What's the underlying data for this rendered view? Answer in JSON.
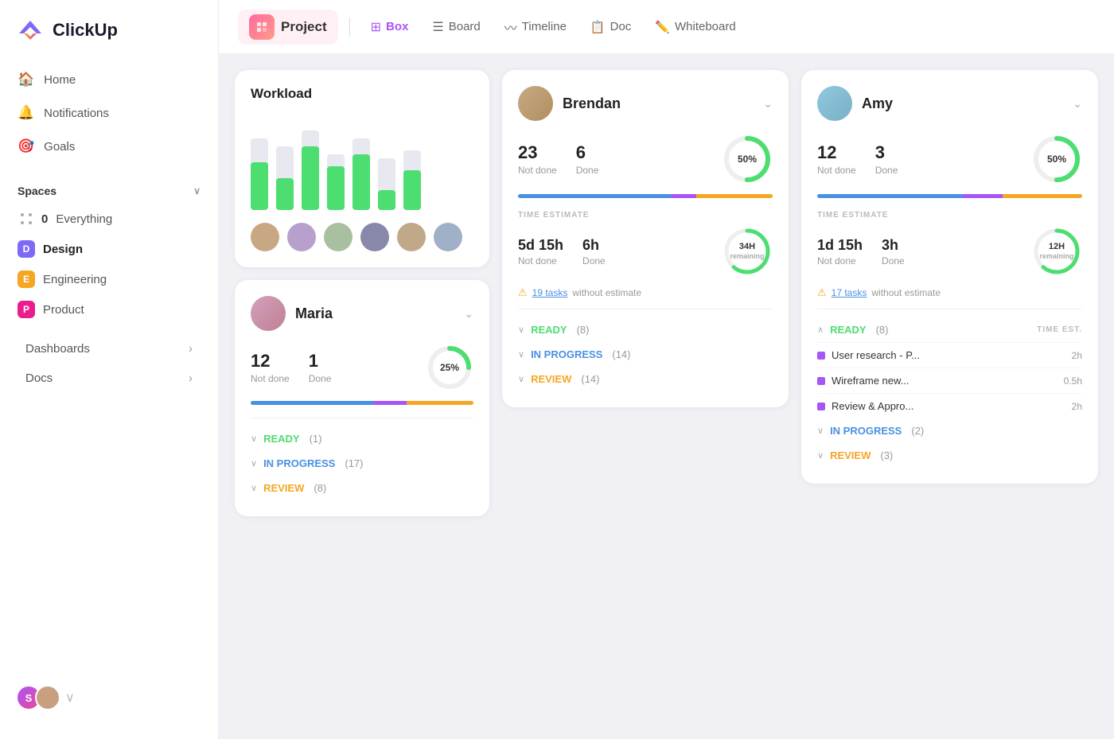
{
  "sidebar": {
    "logo_text": "ClickUp",
    "nav": [
      {
        "label": "Home",
        "icon": "home"
      },
      {
        "label": "Notifications",
        "icon": "bell"
      },
      {
        "label": "Goals",
        "icon": "target"
      }
    ],
    "spaces_title": "Spaces",
    "everything": {
      "num": 0,
      "label": "Everything"
    },
    "spaces": [
      {
        "badge": "D",
        "label": "Design",
        "class": "d",
        "bold": true
      },
      {
        "badge": "E",
        "label": "Engineering",
        "class": "e"
      },
      {
        "badge": "P",
        "label": "Product",
        "class": "p"
      }
    ],
    "bottom": [
      {
        "label": "Dashboards"
      },
      {
        "label": "Docs"
      }
    ]
  },
  "topbar": {
    "project_label": "Project",
    "tabs": [
      {
        "label": "Box",
        "icon": "⊞"
      },
      {
        "label": "Board",
        "icon": "☰"
      },
      {
        "label": "Timeline",
        "icon": "—"
      },
      {
        "label": "Doc",
        "icon": "📄"
      },
      {
        "label": "Whiteboard",
        "icon": "✏️"
      }
    ]
  },
  "workload": {
    "title": "Workload",
    "bars": [
      {
        "bg_h": 90,
        "fill_h": 60
      },
      {
        "bg_h": 80,
        "fill_h": 40
      },
      {
        "bg_h": 100,
        "fill_h": 80
      },
      {
        "bg_h": 70,
        "fill_h": 55
      },
      {
        "bg_h": 90,
        "fill_h": 70
      },
      {
        "bg_h": 65,
        "fill_h": 25
      },
      {
        "bg_h": 75,
        "fill_h": 50
      }
    ]
  },
  "brendan": {
    "name": "Brendan",
    "not_done": 23,
    "not_done_label": "Not done",
    "done": 6,
    "done_label": "Done",
    "percent": 50,
    "percent_label": "50%",
    "time_estimate_label": "TIME ESTIMATE",
    "time_not_done": "5d 15h",
    "time_not_done_label": "Not done",
    "time_done": "6h",
    "time_done_label": "Done",
    "time_remaining": "34H",
    "time_remaining_sub": "remaining",
    "warning_count": "19 tasks",
    "warning_text": "without estimate",
    "ready_label": "READY",
    "ready_count": "(8)",
    "inprogress_label": "IN PROGRESS",
    "inprogress_count": "(14)",
    "review_label": "REVIEW",
    "review_count": "(14)"
  },
  "amy": {
    "name": "Amy",
    "not_done": 12,
    "not_done_label": "Not done",
    "done": 3,
    "done_label": "Done",
    "percent": 50,
    "percent_label": "50%",
    "time_estimate_label": "TIME ESTIMATE",
    "time_not_done": "1d 15h",
    "time_not_done_label": "Not done",
    "time_done": "3h",
    "time_done_label": "Done",
    "time_remaining": "12H",
    "time_remaining_sub": "remaining",
    "warning_count": "17 tasks",
    "warning_text": "without estimate",
    "ready_label": "READY",
    "ready_count": "(8)",
    "time_est_col": "TIME EST.",
    "inprogress_label": "IN PROGRESS",
    "inprogress_count": "(2)",
    "review_label": "REVIEW",
    "review_count": "(3)",
    "tasks": [
      {
        "label": "User research - P...",
        "time": "2h"
      },
      {
        "label": "Wireframe new...",
        "time": "0.5h"
      },
      {
        "label": "Review & Appro...",
        "time": "2h"
      }
    ]
  },
  "maria": {
    "name": "Maria",
    "not_done": 12,
    "not_done_label": "Not done",
    "done": 1,
    "done_label": "Done",
    "percent": 25,
    "percent_label": "25%",
    "ready_label": "READY",
    "ready_count": "(1)",
    "inprogress_label": "IN PROGRESS",
    "inprogress_count": "(17)",
    "review_label": "REVIEW",
    "review_count": "(8)"
  }
}
